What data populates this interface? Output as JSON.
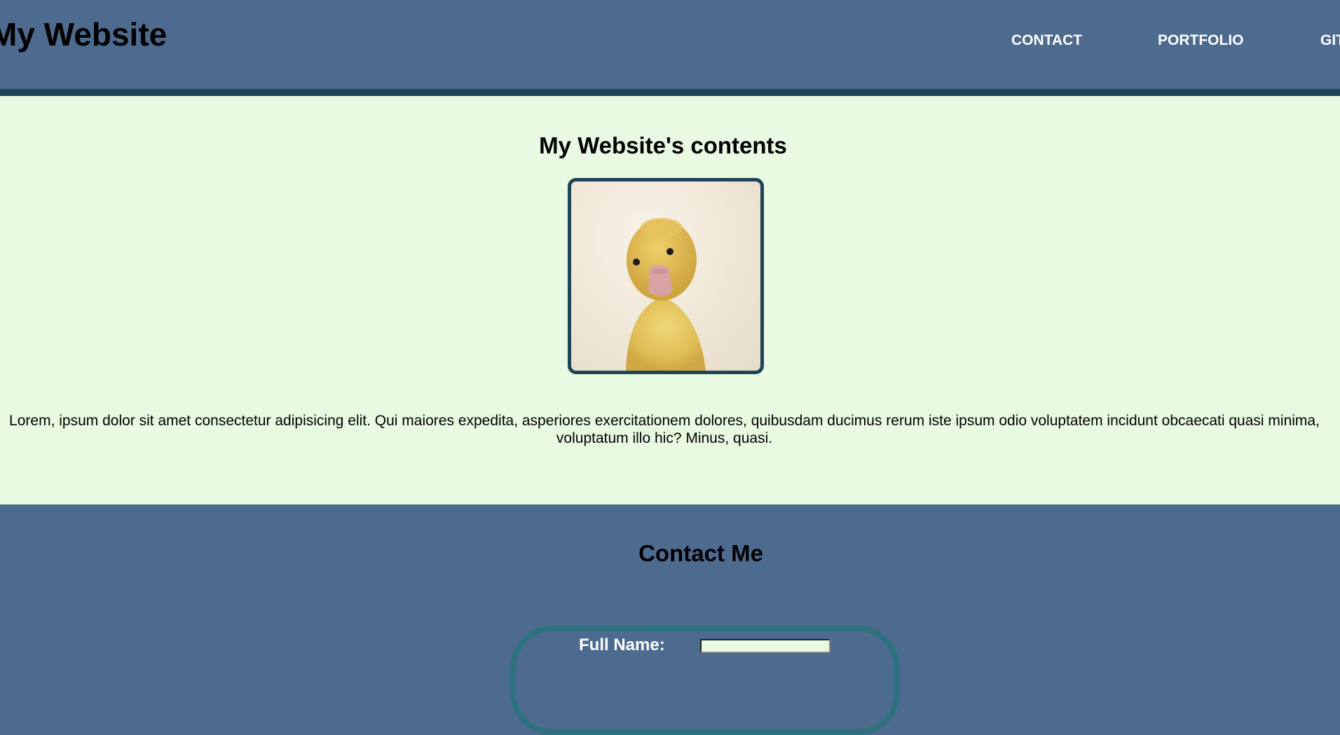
{
  "header": {
    "site_title": "My Website",
    "nav": [
      "CONTACT",
      "PORTFOLIO",
      "GITHUB"
    ]
  },
  "main": {
    "title": "My Website's contents",
    "image_subject": "duckling photo",
    "body": "Lorem, ipsum dolor sit amet consectetur adipisicing elit. Qui maiores expedita, asperiores exercitationem dolores, quibusdam ducimus rerum iste ipsum odio voluptatem incidunt obcaecati quasi minima, voluptatum illo hic? Minus, quasi."
  },
  "contact": {
    "title": "Contact Me",
    "full_name_label": "Full Name:",
    "full_name_value": ""
  },
  "colors": {
    "header_bg": "#4d6a8f",
    "header_border": "#1d4457",
    "main_bg": "#e8fbe2",
    "form_border": "#2d7180"
  }
}
